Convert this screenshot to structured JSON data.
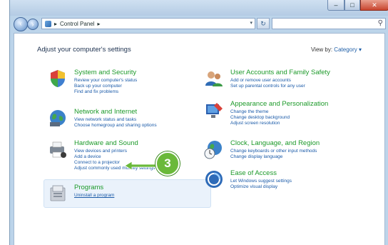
{
  "window": {
    "buttons": {
      "minimize": "–",
      "maximize": "□",
      "close": "✕"
    }
  },
  "navbar": {
    "back": "‹",
    "forward": "›",
    "address": [
      "Control Panel"
    ],
    "address_separator": "▸",
    "refresh": "↻",
    "search_placeholder": ""
  },
  "content": {
    "title": "Adjust your computer's settings",
    "view_by_label": "View by:",
    "view_by_value": "Category ▾"
  },
  "categories": [
    {
      "title": "System and Security",
      "links": [
        "Review your computer's status",
        "Back up your computer",
        "Find and fix problems"
      ],
      "icon": "shield-icon"
    },
    {
      "title": "Network and Internet",
      "links": [
        "View network status and tasks",
        "Choose homegroup and sharing options"
      ],
      "icon": "globe-network-icon"
    },
    {
      "title": "Hardware and Sound",
      "links": [
        "View devices and printers",
        "Add a device",
        "Connect to a projector",
        "Adjust commonly used mobility settings"
      ],
      "icon": "printer-icon"
    },
    {
      "title": "Programs",
      "links": [
        "Uninstall a program"
      ],
      "icon": "programs-icon"
    },
    {
      "title": "User Accounts and Family Safety",
      "links": [
        "Add or remove user accounts",
        "Set up parental controls for any user"
      ],
      "icon": "users-icon"
    },
    {
      "title": "Appearance and Personalization",
      "links": [
        "Change the theme",
        "Change desktop background",
        "Adjust screen resolution"
      ],
      "icon": "paint-icon"
    },
    {
      "title": "Clock, Language, and Region",
      "links": [
        "Change keyboards or other input methods",
        "Change display language"
      ],
      "icon": "clock-globe-icon"
    },
    {
      "title": "Ease of Access",
      "links": [
        "Let Windows suggest settings",
        "Optimize visual display"
      ],
      "icon": "ease-of-access-icon"
    }
  ],
  "callout": {
    "number": "3",
    "color": "#6ab93a"
  }
}
